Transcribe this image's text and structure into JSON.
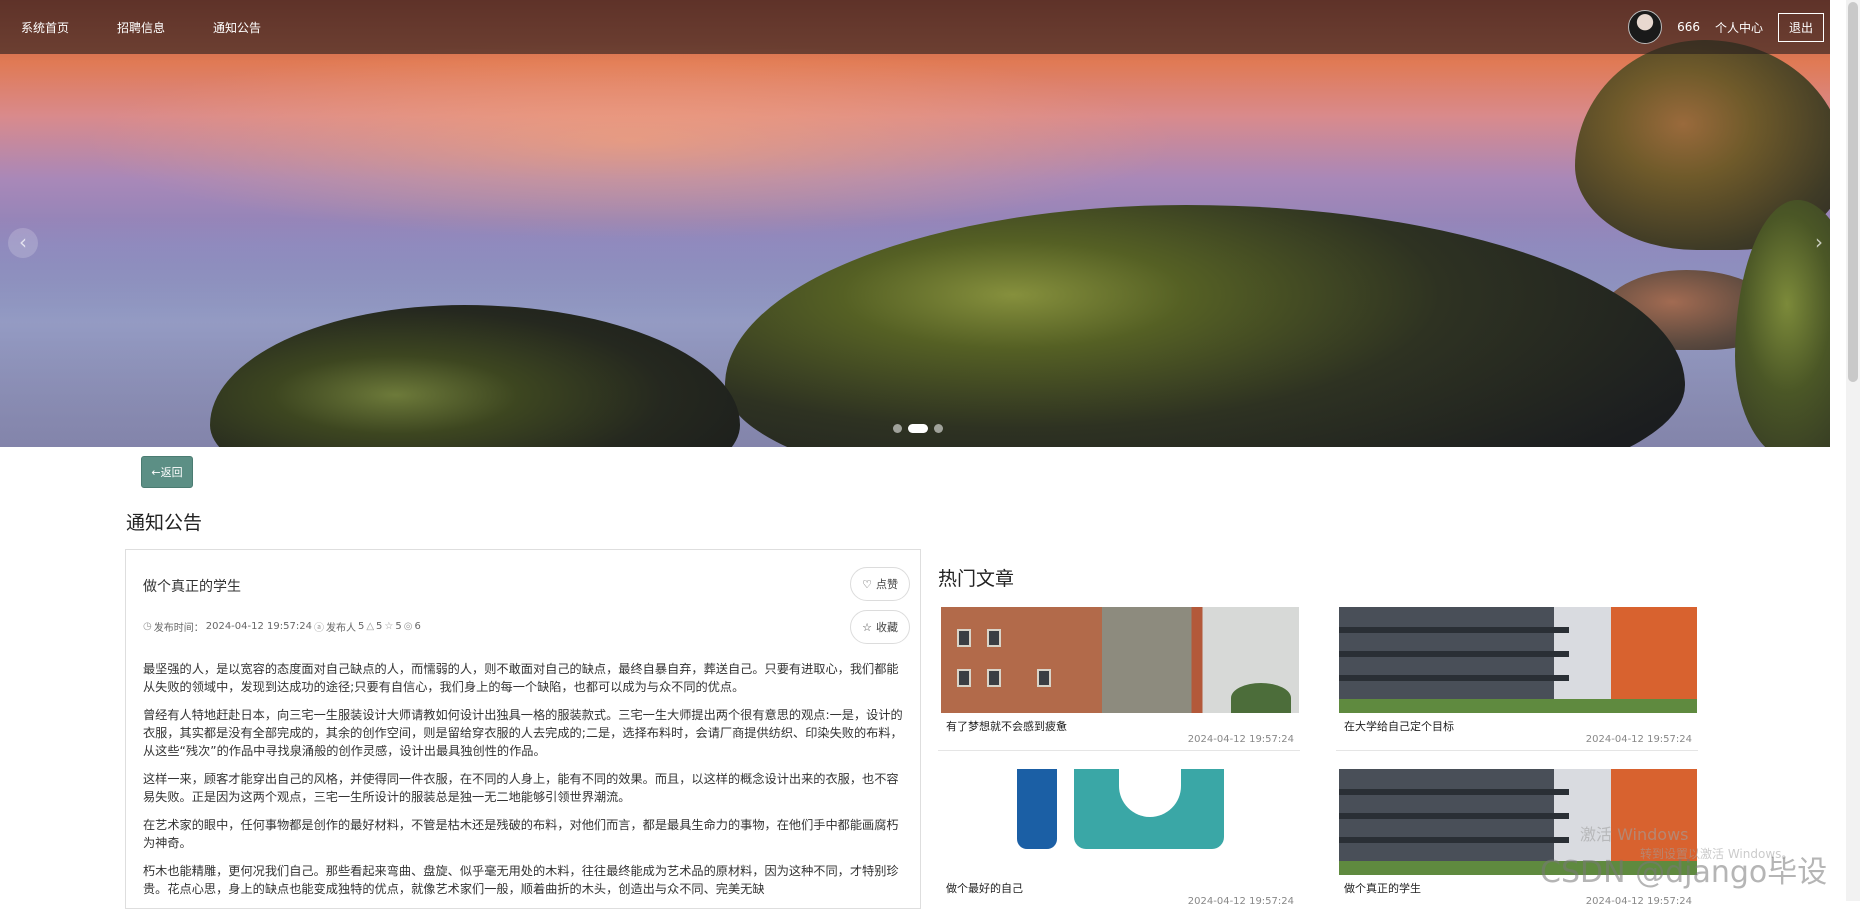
{
  "nav": {
    "items": [
      {
        "label": "系统首页"
      },
      {
        "label": "招聘信息"
      },
      {
        "label": "通知公告"
      }
    ],
    "username": "666",
    "user_center": "个人中心",
    "logout": "退出"
  },
  "carousel": {
    "prev_icon": "‹",
    "next_icon": "›",
    "slide_count": 3,
    "active_index": 1
  },
  "page": {
    "back_label": "←返回",
    "section_title": "通知公告"
  },
  "article": {
    "title": "做个真正的学生",
    "meta": {
      "time_label": "发布时间：",
      "time": "2024-04-12 19:57:24",
      "publisher_label": "发布人",
      "publisher": "5",
      "likes": "5",
      "favorites": "5",
      "views": "6"
    },
    "like_label": "点赞",
    "favorite_label": "收藏",
    "paragraphs": [
      "最坚强的人，是以宽容的态度面对自己缺点的人，而懦弱的人，则不敢面对自己的缺点，最终自暴自弃，葬送自己。只要有进取心，我们都能从失败的领域中，发现到达成功的途径;只要有自信心，我们身上的每一个缺陷，也都可以成为与众不同的优点。",
      "曾经有人特地赶赴日本，向三宅一生服装设计大师请教如何设计出独具一格的服装款式。三宅一生大师提出两个很有意思的观点:一是，设计的衣服，其实都是没有全部完成的，其余的创作空间，则是留给穿衣服的人去完成的;二是，选择布料时，会请厂商提供纺织、印染失败的布料，从这些“残次”的作品中寻找泉涌般的创作灵感，设计出最具独创性的作品。",
      "这样一来，顾客才能穿出自己的风格，并使得同一件衣服，在不同的人身上，能有不同的效果。而且，以这样的概念设计出来的衣服，也不容易失败。正是因为这两个观点，三宅一生所设计的服装总是独一无二地能够引领世界潮流。",
      "在艺术家的眼中，任何事物都是创作的最好材料，不管是枯木还是残破的布料，对他们而言，都是最具生命力的事物，在他们手中都能画腐朽为神奇。",
      "朽木也能精雕，更何况我们自己。那些看起来弯曲、盘旋、似乎毫无用处的木料，往往最终能成为艺术品的原材料，因为这种不同，才特别珍贵。花点心思，身上的缺点也能变成独特的优点，就像艺术家们一般，顺着曲折的木头，创造出与众不同、完美无缺"
    ]
  },
  "hot": {
    "title": "热门文章",
    "items": [
      {
        "title": "有了梦想就不会感到疲惫",
        "date": "2024-04-12 19:57:24",
        "image": "brick-building"
      },
      {
        "title": "在大学给自己定个目标",
        "date": "2024-04-12 19:57:24",
        "image": "glass-building"
      },
      {
        "title": "做个最好的自己",
        "date": "2024-04-12 19:57:24",
        "image": "logo"
      },
      {
        "title": "做个真正的学生",
        "date": "2024-04-12 19:57:24",
        "image": "glass-building"
      }
    ]
  },
  "overlay": {
    "watermark": "CSDN @django毕设",
    "activate_windows": "激活 Windows",
    "activate_hint": "转到设置以激活 Windows。"
  },
  "colors": {
    "nav_bg": "#281e1e",
    "back_button": "#5c8f85",
    "card_border": "#dedede"
  }
}
